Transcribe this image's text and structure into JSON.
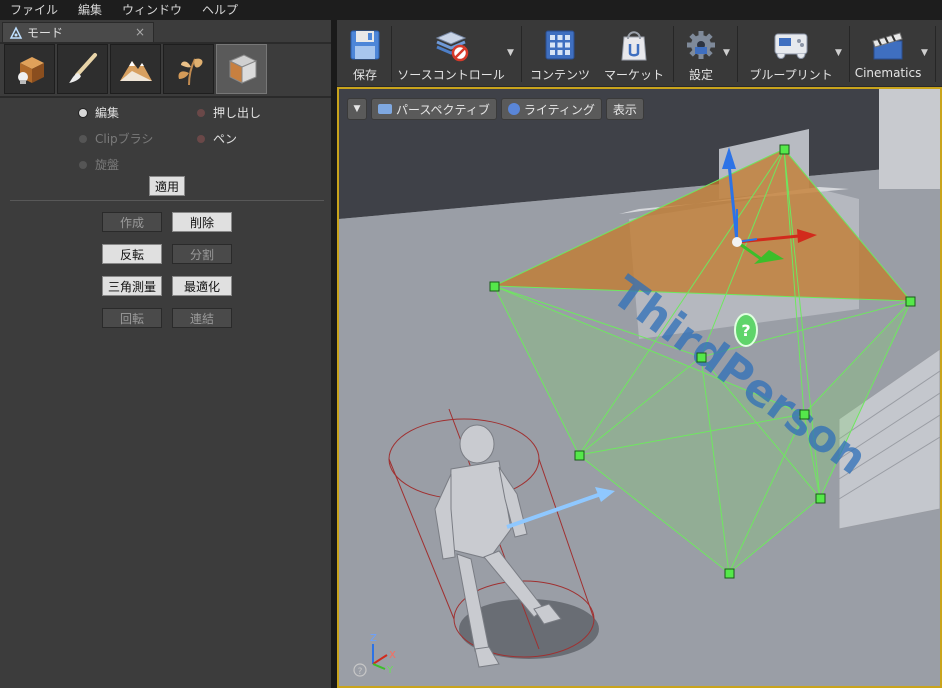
{
  "menu": [
    "ファイル",
    "編集",
    "ウィンドウ",
    "ヘルプ"
  ],
  "panel": {
    "tab_label": "モード",
    "tab_close": "×",
    "modes": [
      "place-mode-icon",
      "paint-mode-icon",
      "landscape-mode-icon",
      "foliage-mode-icon",
      "geometry-mode-icon"
    ],
    "radios": {
      "edit": "編集",
      "extrude": "押し出し",
      "clip": "Clipブラシ",
      "pen": "ペン",
      "lathe": "旋盤"
    },
    "apply": "適用",
    "buttons": {
      "create": "作成",
      "delete": "削除",
      "flip": "反転",
      "split": "分割",
      "triangulate": "三角測量",
      "optimize": "最適化",
      "turn": "回転",
      "weld": "連結"
    }
  },
  "toolbar": {
    "save": "保存",
    "source_control": "ソースコントロール",
    "content": "コンテンツ",
    "marketplace": "マーケット",
    "settings": "設定",
    "blueprints": "ブループリント",
    "cinematics": "Cinematics"
  },
  "viewport": {
    "perspective": "パースペクティブ",
    "lighting": "ライティング",
    "show": "表示",
    "floor_text": "ThirdPerson",
    "axis_z": "Z",
    "axis_x": "X",
    "axis_y": "Y",
    "help_marker": "?",
    "help_corner": "?"
  },
  "colors": {
    "selection_border": "#c9a41c",
    "geometry_edge": "#6ee85f",
    "vertex": "#55e84a",
    "gizmo_x": "#d22a1c",
    "gizmo_y": "#3cbe2a",
    "gizmo_z": "#2d73e6"
  }
}
